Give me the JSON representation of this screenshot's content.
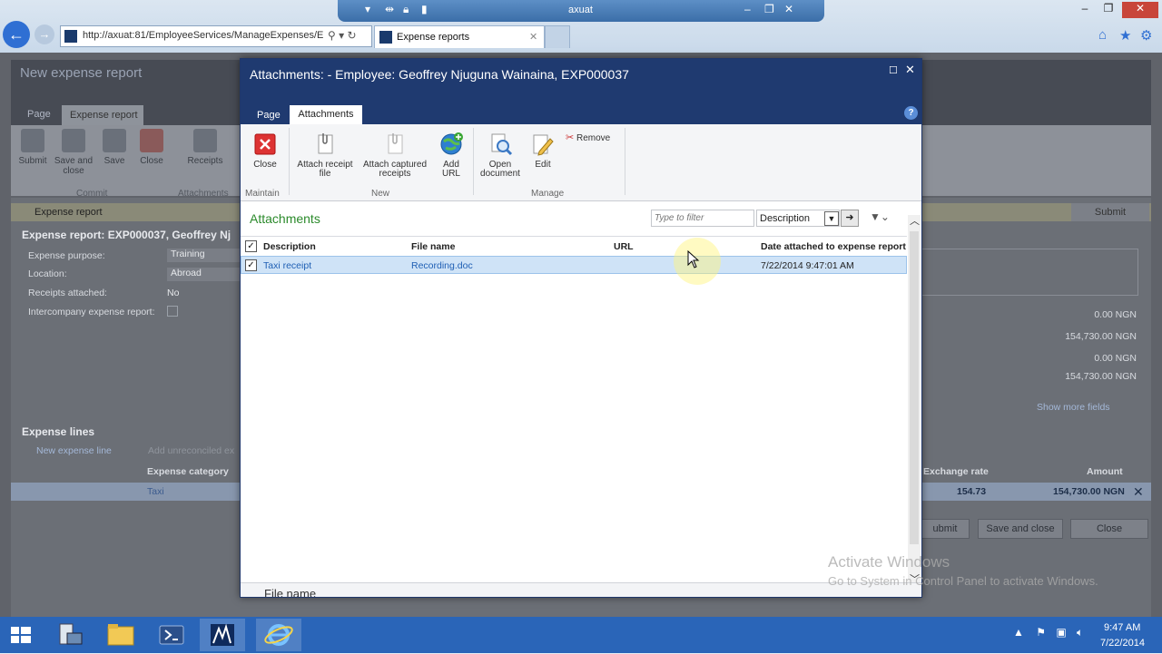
{
  "window": {
    "rdp_title": "axuat"
  },
  "browser": {
    "url": "http://axuat:81/EmployeeServices/ManageExpenses/E",
    "tab_title": "Expense reports"
  },
  "background": {
    "title": "New expense report",
    "ribbon_tabs": [
      "Page",
      "Expense report"
    ],
    "ribbon_buttons": [
      "Submit",
      "Save and close",
      "Save",
      "Close",
      "Receipts"
    ],
    "ribbon_groups": [
      "Commit",
      "Attachments"
    ],
    "factbar_label": "Expense report",
    "submit_label": "Submit",
    "report_header": "Expense report: EXP000037, Geoffrey Nj",
    "fields": [
      {
        "label": "Expense purpose:",
        "value": "Training"
      },
      {
        "label": "Location:",
        "value": "Abroad"
      },
      {
        "label": "Receipts attached:",
        "value": "No"
      },
      {
        "label": "Intercompany expense report:",
        "value": ""
      }
    ],
    "amounts": [
      "0.00 NGN",
      "154,730.00 NGN",
      "0.00 NGN",
      "154,730.00 NGN"
    ],
    "show_more": "Show more fields",
    "lines_header": "Expense lines",
    "new_line": "New expense line",
    "add_unreconciled": "Add unreconciled ex",
    "grid_headers": {
      "category": "Expense category",
      "exchange": "Exchange rate",
      "amount": "Amount"
    },
    "grid_row": {
      "category": "Taxi",
      "exchange": "154.73",
      "amount": "154,730.00 NGN"
    },
    "bottom_buttons": [
      "ubmit",
      "Save and close",
      "Close"
    ]
  },
  "dialog": {
    "title": "Attachments: - Employee: Geoffrey Njuguna Wainaina, EXP000037",
    "tabs": {
      "page": "Page",
      "attachments": "Attachments"
    },
    "buttons": {
      "close": "Close",
      "attach_receipt": "Attach receipt",
      "attach_receipt_2": "file",
      "attach_captured": "Attach captured",
      "attach_captured_2": "receipts",
      "add_url": "Add",
      "add_url_2": "URL",
      "open_doc": "Open",
      "open_doc_2": "document",
      "edit": "Edit",
      "remove": "Remove"
    },
    "groups": {
      "maintain": "Maintain",
      "new": "New",
      "manage": "Manage"
    },
    "section_title": "Attachments",
    "filter": {
      "placeholder": "Type to filter",
      "field": "Description"
    },
    "columns": {
      "description": "Description",
      "file_name": "File name",
      "url": "URL",
      "date": "Date attached to expense report"
    },
    "rows": [
      {
        "description": "Taxi receipt",
        "file_name": "Recording.doc",
        "url": "",
        "date": "7/22/2014 9:47:01 AM"
      }
    ],
    "footer_label": "File name"
  },
  "watermark": {
    "line1": "Activate Windows",
    "line2": "Go to System in Control Panel to activate Windows."
  },
  "taskbar": {
    "time": "9:47 AM",
    "date": "7/22/2014"
  },
  "colors": {
    "dialog_header": "#1f3a70",
    "accent_green": "#2b8a2b",
    "taskbar": "#2a65b8",
    "selection": "#cfe3f7"
  }
}
